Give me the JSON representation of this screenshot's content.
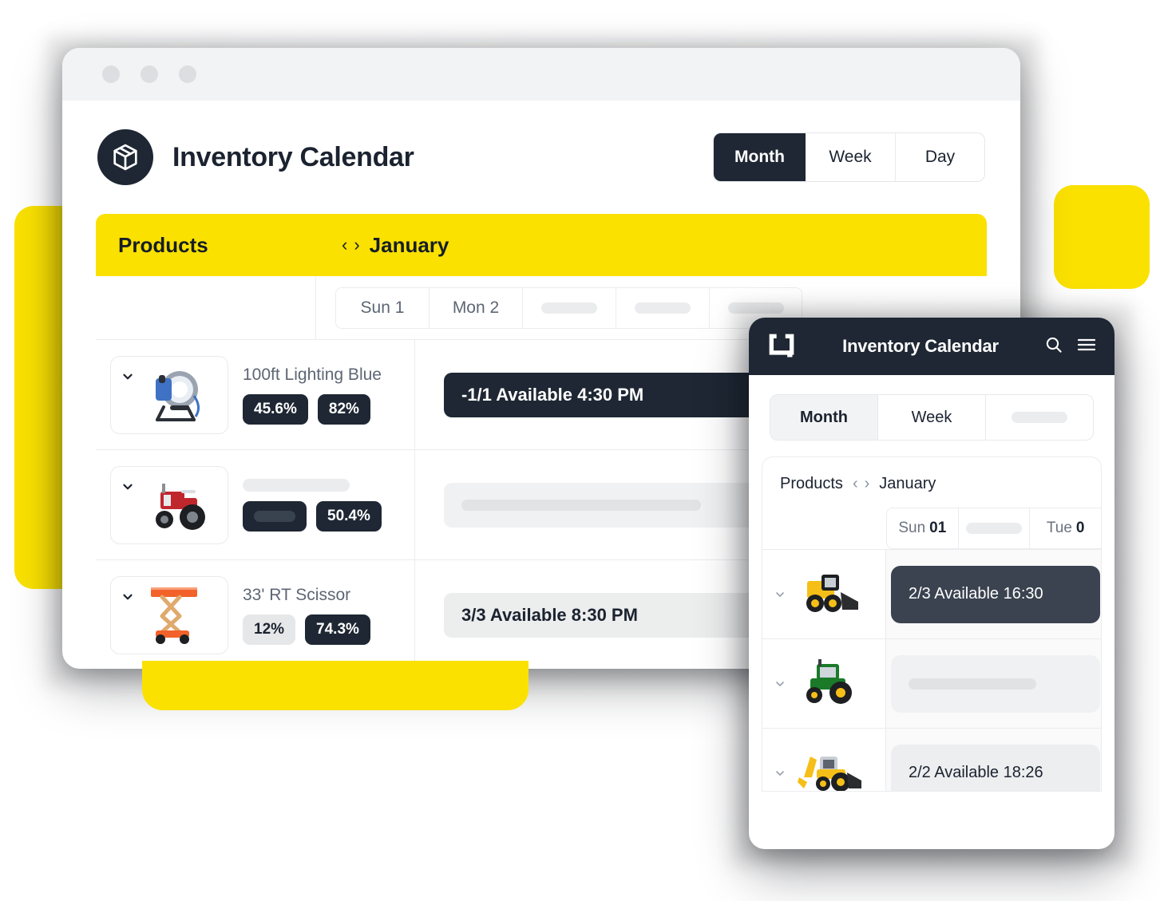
{
  "desktop": {
    "window_controls": [
      "close",
      "minimize",
      "maximize"
    ],
    "brand": {
      "title": "Inventory Calendar",
      "logo_icon": "package-box-icon"
    },
    "view_tabs": [
      {
        "label": "Month",
        "active": true
      },
      {
        "label": "Week",
        "active": false
      },
      {
        "label": "Day",
        "active": false
      }
    ],
    "table_header": {
      "products_label": "Products",
      "prev_icon": "chevron-left-icon",
      "next_icon": "chevron-right-icon",
      "month_label": "January"
    },
    "day_headers": [
      {
        "label": "Sun 1",
        "skeleton": false
      },
      {
        "label": "Mon 2",
        "skeleton": false
      },
      {
        "label": "",
        "skeleton": true
      },
      {
        "label": "",
        "skeleton": true
      },
      {
        "label": "",
        "skeleton": true
      }
    ],
    "rows": [
      {
        "expand_icon": "chevron-down-icon",
        "thumb": "studio-light-thumbnail",
        "name": "100ft Lighting Blue",
        "name_skeleton": false,
        "badges": [
          {
            "label": "45.6%",
            "style": "dark",
            "skeleton": false
          },
          {
            "label": "82%",
            "style": "dark",
            "skeleton": false
          }
        ],
        "event": {
          "label": "-1/1 Available 4:30 PM",
          "style": "dark",
          "skeleton": false
        }
      },
      {
        "expand_icon": "chevron-down-icon",
        "thumb": "red-tractor-thumbnail",
        "name": "",
        "name_skeleton": true,
        "badges": [
          {
            "label": "",
            "style": "dark",
            "skeleton": true
          },
          {
            "label": "50.4%",
            "style": "dark",
            "skeleton": false
          }
        ],
        "event": {
          "label": "",
          "style": "skeleton",
          "skeleton": true
        }
      },
      {
        "expand_icon": "chevron-down-icon",
        "thumb": "orange-scissor-lift-thumbnail",
        "name": "33' RT Scissor",
        "name_skeleton": false,
        "badges": [
          {
            "label": "12%",
            "style": "light",
            "skeleton": false
          },
          {
            "label": "74.3%",
            "style": "dark",
            "skeleton": false
          }
        ],
        "event": {
          "label": "3/3 Available 8:30 PM",
          "style": "light",
          "skeleton": false
        }
      }
    ]
  },
  "mobile": {
    "header": {
      "logo_icon": "app-mark-icon",
      "title": "Inventory Calendar",
      "search_icon": "search-icon",
      "menu_icon": "hamburger-menu-icon"
    },
    "view_tabs": [
      {
        "label": "Month",
        "active": true,
        "skeleton": false
      },
      {
        "label": "Week",
        "active": false,
        "skeleton": false
      },
      {
        "label": "",
        "active": false,
        "skeleton": true
      }
    ],
    "breadcrumb": {
      "products_label": "Products",
      "prev_icon": "chevron-left-icon",
      "next_icon": "chevron-right-icon",
      "month_label": "January"
    },
    "day_headers": [
      {
        "day": "Sun",
        "num": "01",
        "skeleton": false
      },
      {
        "day": "",
        "num": "",
        "skeleton": true
      },
      {
        "day": "Tue",
        "num": "0",
        "skeleton": false
      }
    ],
    "rows": [
      {
        "expand_icon": "chevron-down-icon",
        "thumb": "yellow-skid-steer-thumbnail",
        "event": {
          "label": "2/3 Available  16:30",
          "style": "dark",
          "skeleton": false
        }
      },
      {
        "expand_icon": "chevron-down-icon",
        "thumb": "green-tractor-thumbnail",
        "event": {
          "label": "",
          "style": "skeleton",
          "skeleton": true
        }
      },
      {
        "expand_icon": "chevron-down-icon",
        "thumb": "yellow-backhoe-thumbnail",
        "event": {
          "label": "2/2 Available  18:26",
          "style": "light",
          "skeleton": false
        }
      }
    ]
  },
  "colors": {
    "accent_yellow": "#FAE100",
    "dark": "#1E2733",
    "mobile_event_dark": "#3B4350",
    "light_event": "#ECEDED"
  }
}
